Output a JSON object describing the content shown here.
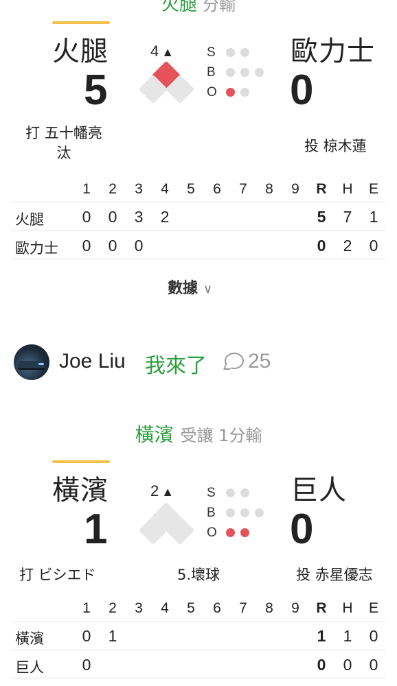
{
  "game1": {
    "header_team": "火腿",
    "header_odds": "分輸",
    "away": {
      "name": "火腿",
      "score": "5"
    },
    "home": {
      "name": "歐力士",
      "score": "0"
    },
    "inning": "4",
    "inning_half_symbol": "▲",
    "count_labels": {
      "s": "S",
      "b": "B",
      "o": "O"
    },
    "batter": "打 五十幡亮汰",
    "batter_line1": "打 五十幡亮",
    "batter_line2": "汰",
    "pitcher": "投 椋木蓮",
    "linescore": {
      "headers": [
        "1",
        "2",
        "3",
        "4",
        "5",
        "6",
        "7",
        "8",
        "9",
        "R",
        "H",
        "E"
      ],
      "rows": [
        {
          "team": "火腿",
          "innings": [
            "0",
            "0",
            "3",
            "2",
            "",
            "",
            "",
            "",
            ""
          ],
          "r": "5",
          "h": "7",
          "e": "1"
        },
        {
          "team": "歐力士",
          "innings": [
            "0",
            "0",
            "0",
            "",
            "",
            "",
            "",
            "",
            ""
          ],
          "r": "0",
          "h": "2",
          "e": "0"
        }
      ]
    },
    "data_link": "數據",
    "chevron_icon": "chevron-down-icon"
  },
  "comment_user": {
    "name": "Joe Liu",
    "pick": "我來了",
    "comment_count": "25",
    "comment_icon": "comment-bubble-icon"
  },
  "game2": {
    "header_team": "橫濱",
    "header_odds": "受讓 1分輸",
    "away": {
      "name": "橫濱",
      "score": "1"
    },
    "home": {
      "name": "巨人",
      "score": "0"
    },
    "inning": "2",
    "inning_half_symbol": "▲",
    "count_labels": {
      "s": "S",
      "b": "B",
      "o": "O"
    },
    "batter": "打 ビシエド",
    "play_status": "5.壞球",
    "pitcher": "投 赤星優志",
    "linescore": {
      "headers": [
        "1",
        "2",
        "3",
        "4",
        "5",
        "6",
        "7",
        "8",
        "9",
        "R",
        "H",
        "E"
      ],
      "rows": [
        {
          "team": "橫濱",
          "innings": [
            "0",
            "1",
            "",
            "",
            "",
            "",
            "",
            "",
            ""
          ],
          "r": "1",
          "h": "1",
          "e": "0"
        },
        {
          "team": "巨人",
          "innings": [
            "0",
            "",
            "",
            "",
            "",
            "",
            "",
            "",
            ""
          ],
          "r": "0",
          "h": "0",
          "e": "0"
        }
      ]
    }
  },
  "colors": {
    "accent_green": "#2a9d3c",
    "runner_red": "#e5525a",
    "batting_underline": "#f2c14a",
    "muted_gray": "#999999"
  }
}
